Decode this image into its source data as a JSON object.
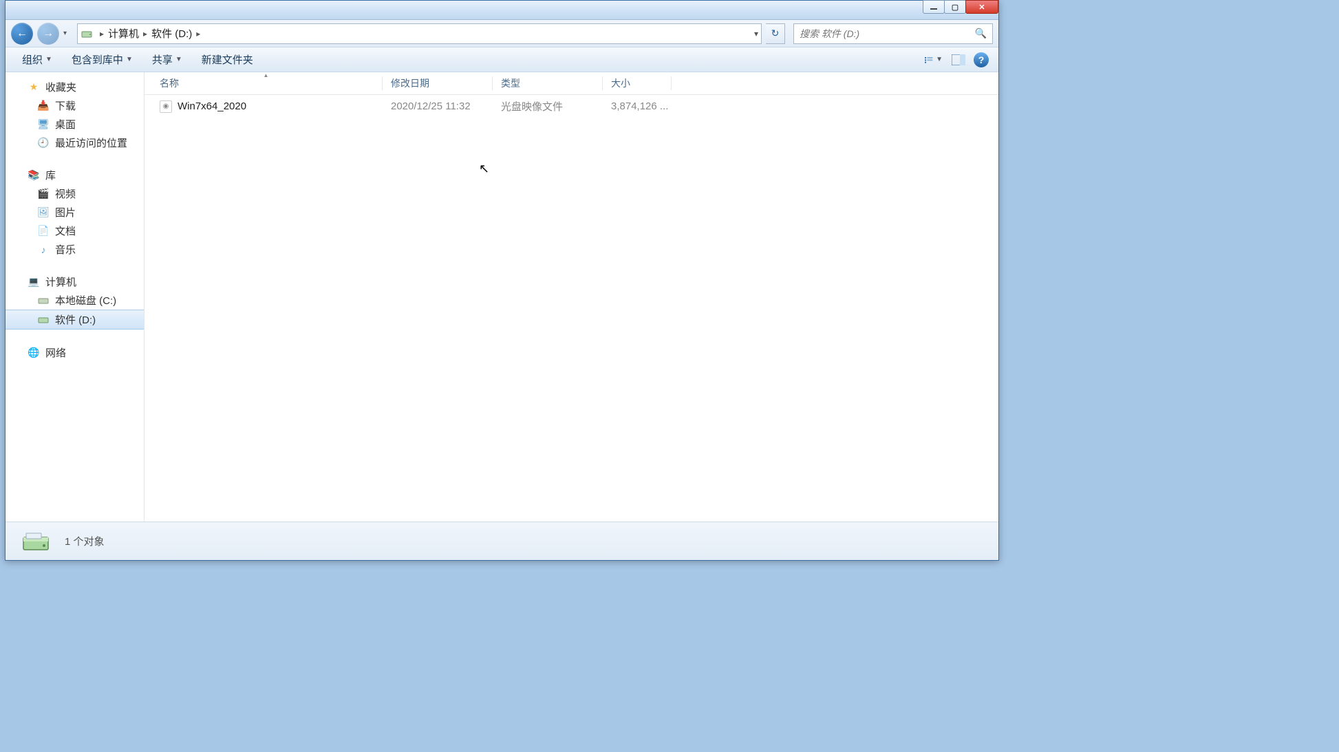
{
  "breadcrumb": {
    "computer": "计算机",
    "drive": "软件 (D:)"
  },
  "search": {
    "placeholder": "搜索 软件 (D:)"
  },
  "toolbar": {
    "organize": "组织",
    "include": "包含到库中",
    "share": "共享",
    "newfolder": "新建文件夹"
  },
  "columns": {
    "name": "名称",
    "date": "修改日期",
    "type": "类型",
    "size": "大小"
  },
  "sidebar": {
    "favorites": "收藏夹",
    "downloads": "下载",
    "desktop": "桌面",
    "recent": "最近访问的位置",
    "libraries": "库",
    "videos": "视频",
    "pictures": "图片",
    "documents": "文档",
    "music": "音乐",
    "computer": "计算机",
    "drive_c": "本地磁盘 (C:)",
    "drive_d": "软件 (D:)",
    "network": "网络"
  },
  "files": [
    {
      "name": "Win7x64_2020",
      "date": "2020/12/25 11:32",
      "type": "光盘映像文件",
      "size": "3,874,126 ..."
    }
  ],
  "status": {
    "count": "1 个对象"
  }
}
